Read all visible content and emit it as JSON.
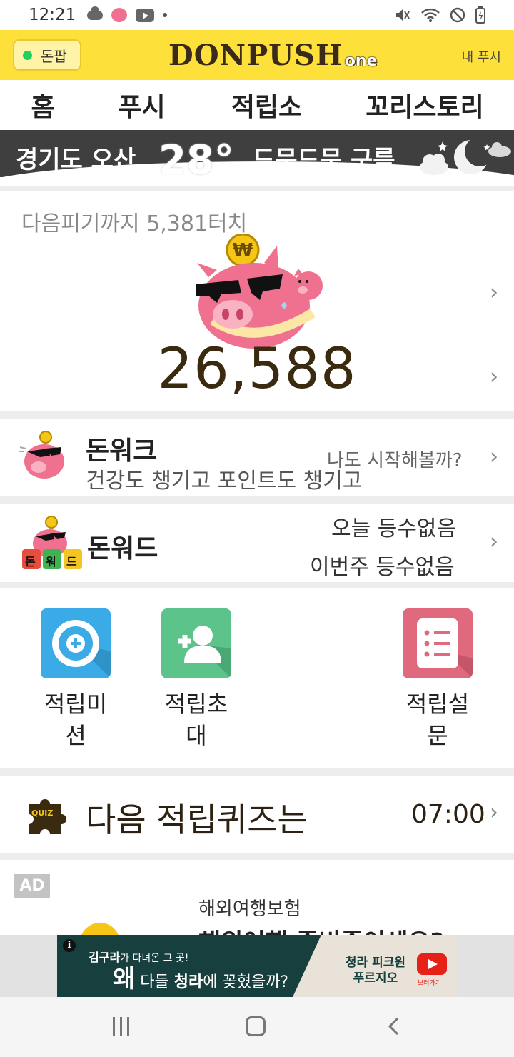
{
  "status_bar": {
    "time": "12:21"
  },
  "header": {
    "donpop_label": "돈팝",
    "logo_main": "DONPUSH",
    "logo_suffix": "one",
    "my_push_label": "내 푸시"
  },
  "tabs": [
    {
      "label": "홈",
      "active": true
    },
    {
      "label": "푸시",
      "active": false
    },
    {
      "label": "적립소",
      "active": false
    },
    {
      "label": "꼬리스토리",
      "active": false
    }
  ],
  "weather": {
    "location": "경기도 오산",
    "temperature": "28°",
    "condition": "드문드문 구름"
  },
  "piggy": {
    "next_pig_text": "다음피기까지 5,381터치",
    "balance": "26,588"
  },
  "donwalk": {
    "title": "돈워크",
    "subtitle": "건강도 챙기고 포인트도 챙기고",
    "cta": "나도 시작해볼까?"
  },
  "donword": {
    "title": "돈워드",
    "tiles": [
      "돈",
      "워",
      "드"
    ],
    "today": "오늘 등수없음",
    "this_week": "이번주 등수없음"
  },
  "actions": [
    {
      "label": "적립미\n션",
      "icon": "target-plus-icon",
      "color": "#3aabe6"
    },
    {
      "label": "적립초\n대",
      "icon": "add-person-icon",
      "color": "#5cc48a"
    },
    {
      "label": "적립설\n문",
      "icon": "survey-list-icon",
      "color": "#e0697e"
    }
  ],
  "quiz": {
    "icon_label": "QUIZ",
    "title": "다음 적립퀴즈는",
    "time": "07:00"
  },
  "ad_card": {
    "tag": "AD",
    "subtitle": "해외여행보험",
    "headline": "해외여행 준비중이세요?"
  },
  "banner_ad": {
    "line1_name": "김구라",
    "line1_rest": "가 다녀온 그 곳!",
    "line2_big": "왜",
    "line2_pre": " 다들 ",
    "line2_bold": "청라",
    "line2_rest": "에 꽂혔을까?",
    "brand": "청라 피크원\n푸르지오",
    "video_label": "보러가기"
  },
  "colors": {
    "header_yellow": "#fde03a",
    "brown_text": "#3a2a10",
    "pig_pink": "#f0708f"
  }
}
